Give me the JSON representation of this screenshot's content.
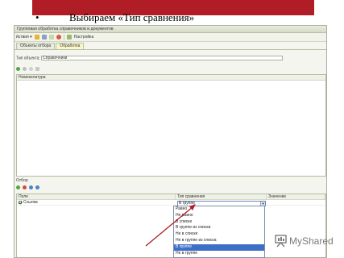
{
  "slide": {
    "bullet": "•",
    "title": "Выбираем «Тип сравнения»"
  },
  "window": {
    "title": "Групповая обработка справочников и документов",
    "toolbar": {
      "actions_label": "йствия ▾",
      "settings_label": "Настройка"
    },
    "tabs": [
      "Объекты отбора",
      "Обработка"
    ],
    "object_type_label": "Тип объекта:",
    "object_type_value": "Справочники",
    "list_header": "Номенклатура",
    "filter_label": "Отбор",
    "filter_table": {
      "columns": [
        "Поле",
        "Тип сравнения",
        "Значение"
      ],
      "rows": [
        {
          "field": "Ссылка",
          "comparison": "В группе"
        }
      ]
    },
    "comparison_options": [
      "Равно",
      "Не равно",
      "В списке",
      "В группе из списка",
      "Не в списке",
      "Не в группе из списка",
      "В группе",
      "Не в группе"
    ],
    "selected_index": 6
  },
  "watermark": {
    "text": "MyShared"
  },
  "colors": {
    "banner": "#b01d26",
    "selection": "#3e6fc6",
    "arrow": "#b01d26"
  }
}
